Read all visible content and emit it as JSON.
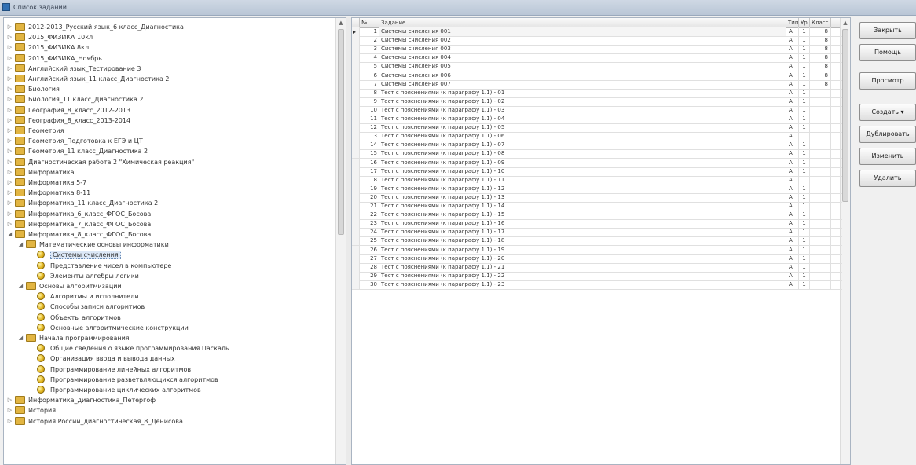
{
  "window": {
    "title": "Список заданий"
  },
  "tree": {
    "items": [
      {
        "label": "2012-2013_Русский язык_6 класс_Диагностика",
        "kind": "folder",
        "level": 0
      },
      {
        "label": "2015_ФИЗИКА 10кл",
        "kind": "folder",
        "level": 0
      },
      {
        "label": "2015_ФИЗИКА 8кл",
        "kind": "folder",
        "level": 0
      },
      {
        "label": "2015_ФИЗИКА_Ноябрь",
        "kind": "folder",
        "level": 0
      },
      {
        "label": "Английский язык_Тестирование 3",
        "kind": "folder",
        "level": 0
      },
      {
        "label": "Английский язык_11 класс_Диагностика 2",
        "kind": "folder",
        "level": 0
      },
      {
        "label": "Биология",
        "kind": "folder",
        "level": 0
      },
      {
        "label": "Биология_11 класс_Диагностика 2",
        "kind": "folder",
        "level": 0
      },
      {
        "label": "География_8_класс_2012-2013",
        "kind": "folder",
        "level": 0
      },
      {
        "label": "География_8_класс_2013-2014",
        "kind": "folder",
        "level": 0
      },
      {
        "label": "Геометрия",
        "kind": "folder",
        "level": 0
      },
      {
        "label": "Геометрия_Подготовка к ЕГЭ и ЦТ",
        "kind": "folder",
        "level": 0
      },
      {
        "label": "Геометрия_11 класс_Диагностика 2",
        "kind": "folder",
        "level": 0
      },
      {
        "label": "Диагностическая работа 2 \"Химическая реакция\"",
        "kind": "folder",
        "level": 0
      },
      {
        "label": "Информатика",
        "kind": "folder",
        "level": 0
      },
      {
        "label": "Информатика 5-7",
        "kind": "folder",
        "level": 0
      },
      {
        "label": "Информатика 8-11",
        "kind": "folder",
        "level": 0
      },
      {
        "label": "Информатика_11 класс_Диагностика 2",
        "kind": "folder",
        "level": 0
      },
      {
        "label": "Информатика_6_класс_ФГОС_Босова",
        "kind": "folder",
        "level": 0
      },
      {
        "label": "Информатика_7_класс_ФГОС_Босова",
        "kind": "folder",
        "level": 0
      },
      {
        "label": "Информатика_8_класс_ФГОС_Босова",
        "kind": "folder",
        "level": 0,
        "expanded": true
      },
      {
        "label": "Математические основы информатики",
        "kind": "folder",
        "level": 1,
        "expanded": true
      },
      {
        "label": "Системы счисления",
        "kind": "topic",
        "level": 2,
        "selected": true
      },
      {
        "label": "Представление чисел в компьютере",
        "kind": "topic",
        "level": 2
      },
      {
        "label": "Элементы алгебры логики",
        "kind": "topic",
        "level": 2
      },
      {
        "label": "Основы алгоритмизации",
        "kind": "folder",
        "level": 1,
        "expanded": true
      },
      {
        "label": "Алгоритмы и исполнители",
        "kind": "topic",
        "level": 2
      },
      {
        "label": "Способы записи алгоритмов",
        "kind": "topic",
        "level": 2
      },
      {
        "label": "Объекты алгоритмов",
        "kind": "topic",
        "level": 2
      },
      {
        "label": "Основные алгоритмические конструкции",
        "kind": "topic",
        "level": 2
      },
      {
        "label": "Начала программирования",
        "kind": "folder",
        "level": 1,
        "expanded": true
      },
      {
        "label": "Общие сведения о языке программирования Паскаль",
        "kind": "topic",
        "level": 2
      },
      {
        "label": "Организация ввода и вывода данных",
        "kind": "topic",
        "level": 2
      },
      {
        "label": "Программирование линейных алгоритмов",
        "kind": "topic",
        "level": 2
      },
      {
        "label": "Программирование разветвляющихся алгоритмов",
        "kind": "topic",
        "level": 2
      },
      {
        "label": "Программирование циклических алгоритмов",
        "kind": "topic",
        "level": 2
      },
      {
        "label": "Информатика_диагностика_Петергоф",
        "kind": "folder",
        "level": 0
      },
      {
        "label": "История",
        "kind": "folder",
        "level": 0
      },
      {
        "label": "История России_диагностическая_8_Денисова",
        "kind": "folder",
        "level": 0
      }
    ]
  },
  "grid": {
    "headers": {
      "num": "№",
      "task": "Задание",
      "type": "Тип",
      "level": "Ур.",
      "class": "Класс"
    },
    "rows": [
      {
        "num": "1",
        "task": "Системы счисления 001",
        "type": "A",
        "level": "1",
        "class": "8"
      },
      {
        "num": "2",
        "task": "Системы счисления 002",
        "type": "A",
        "level": "1",
        "class": "8"
      },
      {
        "num": "3",
        "task": "Системы счисления 003",
        "type": "A",
        "level": "1",
        "class": "8"
      },
      {
        "num": "4",
        "task": "Системы счисления 004",
        "type": "A",
        "level": "1",
        "class": "8"
      },
      {
        "num": "5",
        "task": "Системы счисления 005",
        "type": "A",
        "level": "1",
        "class": "8"
      },
      {
        "num": "6",
        "task": "Системы счисления 006",
        "type": "A",
        "level": "1",
        "class": "8"
      },
      {
        "num": "7",
        "task": "Системы счисления 007",
        "type": "A",
        "level": "1",
        "class": "8"
      },
      {
        "num": "8",
        "task": "Тест с пояснениями (к параграфу 1.1) - 01",
        "type": "A",
        "level": "1",
        "class": ""
      },
      {
        "num": "9",
        "task": "Тест с пояснениями (к параграфу 1.1) - 02",
        "type": "A",
        "level": "1",
        "class": ""
      },
      {
        "num": "10",
        "task": "Тест с пояснениями (к параграфу 1.1) - 03",
        "type": "A",
        "level": "1",
        "class": ""
      },
      {
        "num": "11",
        "task": "Тест с пояснениями (к параграфу 1.1) - 04",
        "type": "A",
        "level": "1",
        "class": ""
      },
      {
        "num": "12",
        "task": "Тест с пояснениями (к параграфу 1.1) - 05",
        "type": "A",
        "level": "1",
        "class": ""
      },
      {
        "num": "13",
        "task": "Тест с пояснениями (к параграфу 1.1) - 06",
        "type": "A",
        "level": "1",
        "class": ""
      },
      {
        "num": "14",
        "task": "Тест с пояснениями (к параграфу 1.1) - 07",
        "type": "A",
        "level": "1",
        "class": ""
      },
      {
        "num": "15",
        "task": "Тест с пояснениями (к параграфу 1.1) - 08",
        "type": "A",
        "level": "1",
        "class": ""
      },
      {
        "num": "16",
        "task": "Тест с пояснениями (к параграфу 1.1) - 09",
        "type": "A",
        "level": "1",
        "class": ""
      },
      {
        "num": "17",
        "task": "Тест с пояснениями (к параграфу 1.1) - 10",
        "type": "A",
        "level": "1",
        "class": ""
      },
      {
        "num": "18",
        "task": "Тест с пояснениями (к параграфу 1.1) - 11",
        "type": "A",
        "level": "1",
        "class": ""
      },
      {
        "num": "19",
        "task": "Тест с пояснениями (к параграфу 1.1) - 12",
        "type": "A",
        "level": "1",
        "class": ""
      },
      {
        "num": "20",
        "task": "Тест с пояснениями (к параграфу 1.1) - 13",
        "type": "A",
        "level": "1",
        "class": ""
      },
      {
        "num": "21",
        "task": "Тест с пояснениями (к параграфу 1.1) - 14",
        "type": "A",
        "level": "1",
        "class": ""
      },
      {
        "num": "22",
        "task": "Тест с пояснениями (к параграфу 1.1) - 15",
        "type": "A",
        "level": "1",
        "class": ""
      },
      {
        "num": "23",
        "task": "Тест с пояснениями (к параграфу 1.1) - 16",
        "type": "A",
        "level": "1",
        "class": ""
      },
      {
        "num": "24",
        "task": "Тест с пояснениями (к параграфу 1.1) - 17",
        "type": "A",
        "level": "1",
        "class": ""
      },
      {
        "num": "25",
        "task": "Тест с пояснениями (к параграфу 1.1) - 18",
        "type": "A",
        "level": "1",
        "class": ""
      },
      {
        "num": "26",
        "task": "Тест с пояснениями (к параграфу 1.1) - 19",
        "type": "A",
        "level": "1",
        "class": ""
      },
      {
        "num": "27",
        "task": "Тест с пояснениями (к параграфу 1.1) - 20",
        "type": "A",
        "level": "1",
        "class": ""
      },
      {
        "num": "28",
        "task": "Тест с пояснениями (к параграфу 1.1) - 21",
        "type": "A",
        "level": "1",
        "class": ""
      },
      {
        "num": "29",
        "task": "Тест с пояснениями (к параграфу 1.1) - 22",
        "type": "A",
        "level": "1",
        "class": ""
      },
      {
        "num": "30",
        "task": "Тест с пояснениями (к параграфу 1.1) - 23",
        "type": "A",
        "level": "1",
        "class": ""
      }
    ]
  },
  "buttons": {
    "close": "Закрыть",
    "help": "Помощь",
    "preview": "Просмотр",
    "create": "Создать ▾",
    "duplicate": "Дублировать",
    "edit": "Изменить",
    "delete": "Удалить"
  }
}
